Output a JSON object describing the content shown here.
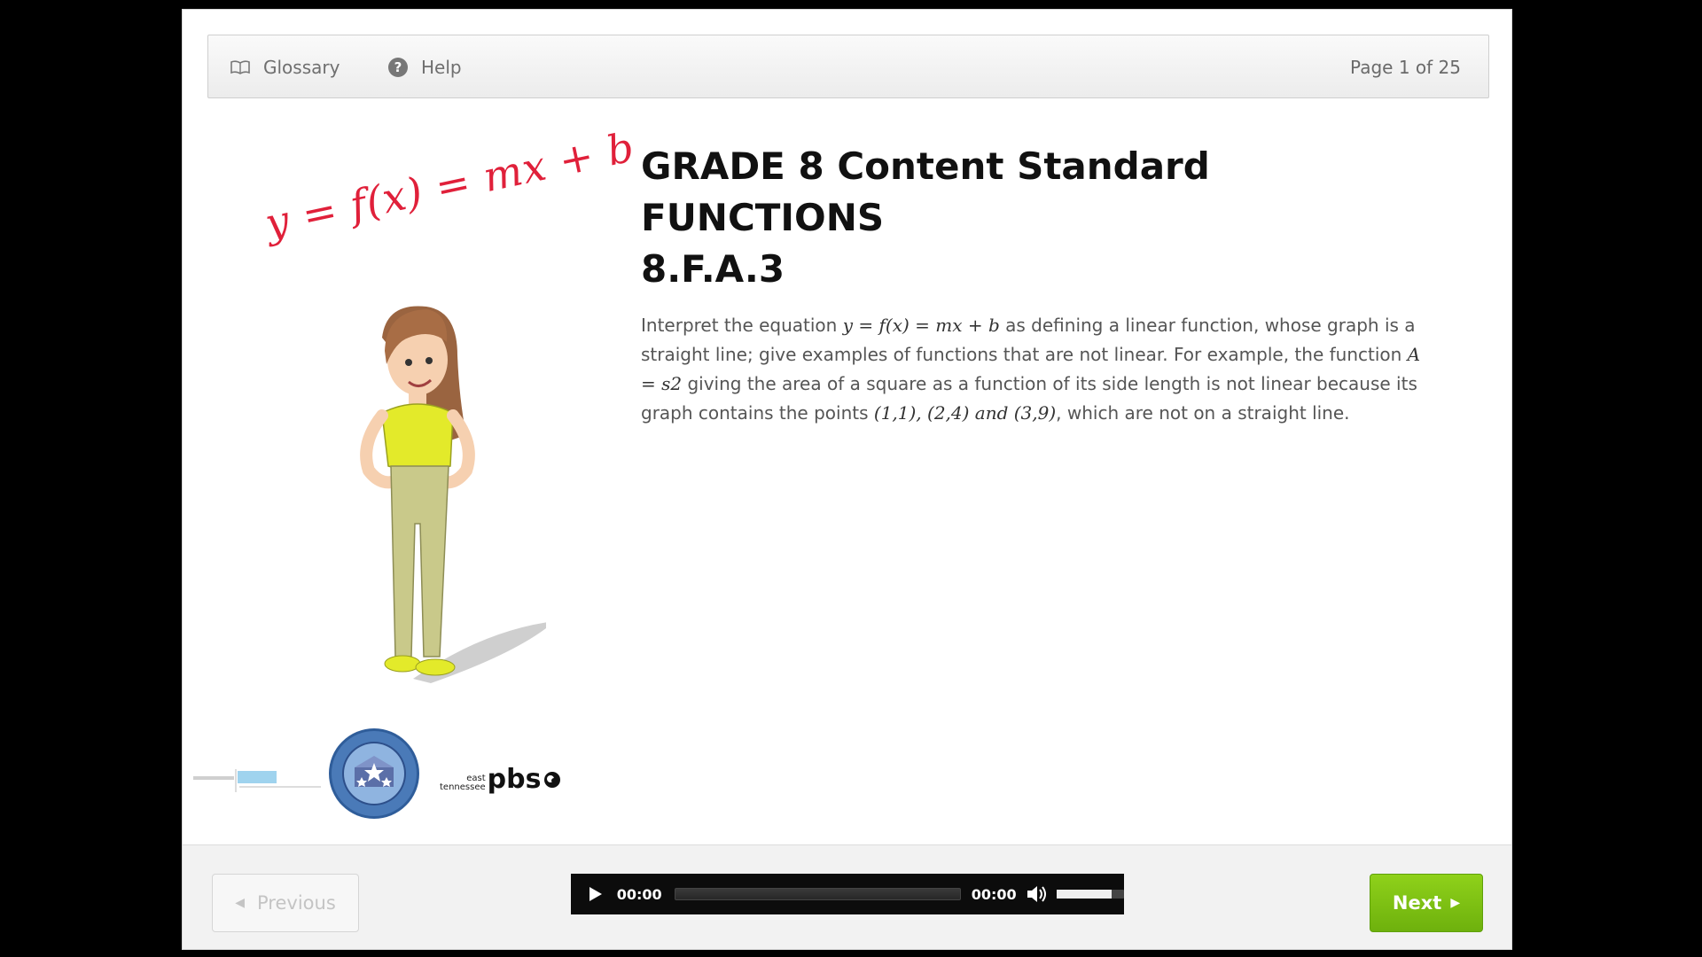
{
  "toolbar": {
    "glossary_label": "Glossary",
    "help_label": "Help",
    "page_indicator": "Page 1 of 25"
  },
  "illustration": {
    "equation": "y = f(x) = mx + b"
  },
  "content": {
    "heading_line1": "GRADE 8 Content Standard",
    "heading_line2": "FUNCTIONS",
    "heading_line3": "8.F.A.3",
    "p1": "Interpret the equation ",
    "eq1": "y = f(x) = mx + b",
    "p2": " as defining a linear function, whose graph is a straight line; give examples of functions that are not linear. For example, the function ",
    "eq2": "A = s2",
    "p3": " giving the area of a square as a function of its side length is not linear because its graph contains the points ",
    "eq3": "(1,1), (2,4) and (3,9)",
    "p4": ", which are not on a straight line."
  },
  "logos": {
    "pbs_small_top": "east",
    "pbs_small_bottom": "tennessee",
    "pbs_big": "pbs"
  },
  "footer": {
    "previous_label": "Previous",
    "next_label": "Next",
    "audio": {
      "current_time": "00:00",
      "duration": "00:00",
      "volume_fraction": 0.82
    }
  },
  "colors": {
    "next_green": "#7cc012",
    "equation_red": "#e0203a"
  }
}
